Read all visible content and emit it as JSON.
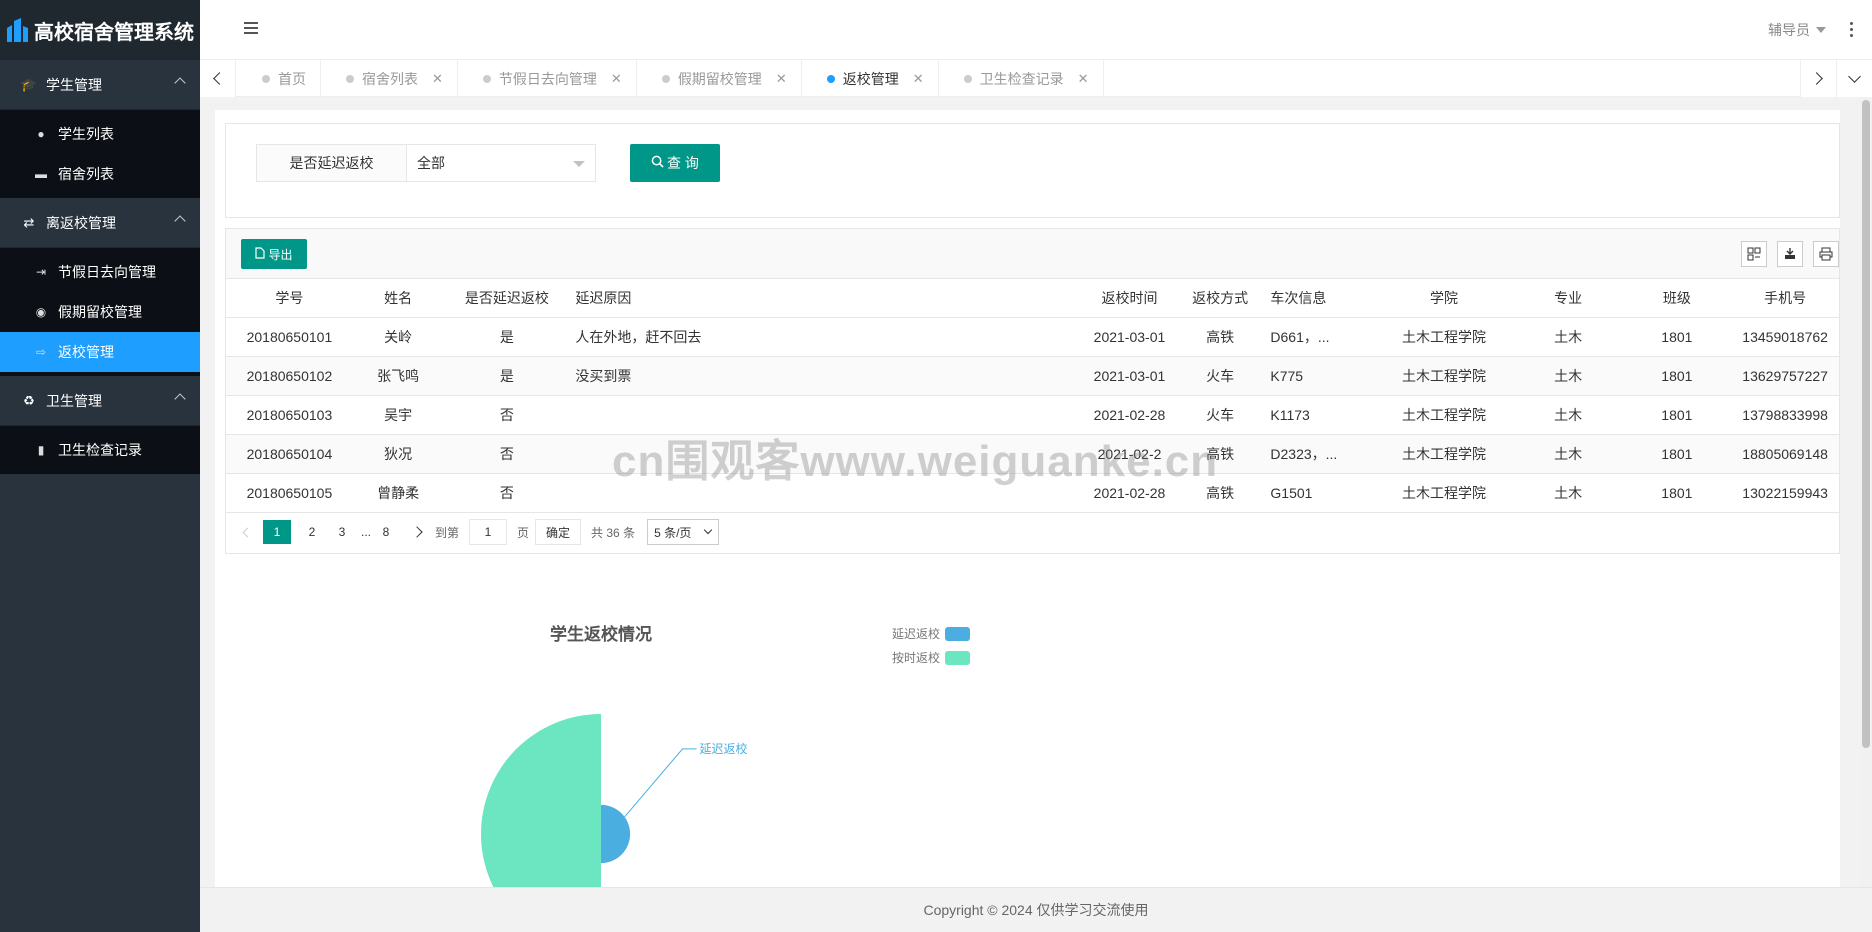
{
  "app": {
    "title": "高校宿舍管理系统"
  },
  "sidebar": {
    "groups": [
      {
        "label": "学生管理",
        "icon": "graduation-cap-icon",
        "items": [
          {
            "label": "学生列表",
            "icon": "user-icon"
          },
          {
            "label": "宿舍列表",
            "icon": "bed-icon"
          }
        ]
      },
      {
        "label": "离返校管理",
        "icon": "exchange-icon",
        "items": [
          {
            "label": "节假日去向管理",
            "icon": "sign-out-icon"
          },
          {
            "label": "假期留校管理",
            "icon": "globe-icon"
          },
          {
            "label": "返校管理",
            "icon": "sign-in-icon"
          }
        ]
      },
      {
        "label": "卫生管理",
        "icon": "recycle-icon",
        "items": [
          {
            "label": "卫生检查记录",
            "icon": "bar-chart-icon"
          }
        ]
      }
    ]
  },
  "header": {
    "user": "辅导员"
  },
  "tabs": [
    "首页",
    "宿舍列表",
    "节假日去向管理",
    "假期留校管理",
    "返校管理",
    "卫生检查记录"
  ],
  "search": {
    "label": "是否延迟返校",
    "value": "全部",
    "button": "查 询"
  },
  "toolbar": {
    "export": "导出"
  },
  "table": {
    "columns": [
      "学号",
      "姓名",
      "是否延迟返校",
      "延迟原因",
      "返校时间",
      "返校方式",
      "车次信息",
      "学院",
      "专业",
      "班级",
      "手机号"
    ],
    "rows": [
      [
        "20180650101",
        "关岭",
        "是",
        "人在外地，赶不回去",
        "2021-03-01",
        "高铁",
        "D661，...",
        "土木工程学院",
        "土木",
        "1801",
        "13459018762"
      ],
      [
        "20180650102",
        "张飞鸣",
        "是",
        "没买到票",
        "2021-03-01",
        "火车",
        "K775",
        "土木工程学院",
        "土木",
        "1801",
        "13629757227"
      ],
      [
        "20180650103",
        "吴宇",
        "否",
        "",
        "2021-02-28",
        "火车",
        "K1173",
        "土木工程学院",
        "土木",
        "1801",
        "13798833998"
      ],
      [
        "20180650104",
        "狄况",
        "否",
        "",
        "2021-02-2",
        "高铁",
        "D2323，...",
        "土木工程学院",
        "土木",
        "1801",
        "18805069148"
      ],
      [
        "20180650105",
        "曾静柔",
        "否",
        "",
        "2021-02-28",
        "高铁",
        "G1501",
        "土木工程学院",
        "土木",
        "1801",
        "13022159943"
      ]
    ]
  },
  "pager": {
    "pages": [
      "1",
      "2",
      "3",
      "...",
      "8"
    ],
    "goto_label": "到第",
    "goto_value": "1",
    "page_unit": "页",
    "confirm": "确定",
    "total": "共 36 条",
    "page_size": "5 条/页"
  },
  "chart_data": {
    "type": "pie",
    "title": "学生返校情况",
    "rose": true,
    "categories": [
      "延迟返校",
      "按时返校"
    ],
    "values": [
      2,
      34
    ],
    "colors": [
      "#4aaee0",
      "#6ce6c1"
    ],
    "annotations": [
      "延迟返校"
    ]
  },
  "footer": {
    "text": "Copyright © 2024 仅供学习交流使用"
  },
  "watermark": "cn围观客www.weiguanke.cn"
}
